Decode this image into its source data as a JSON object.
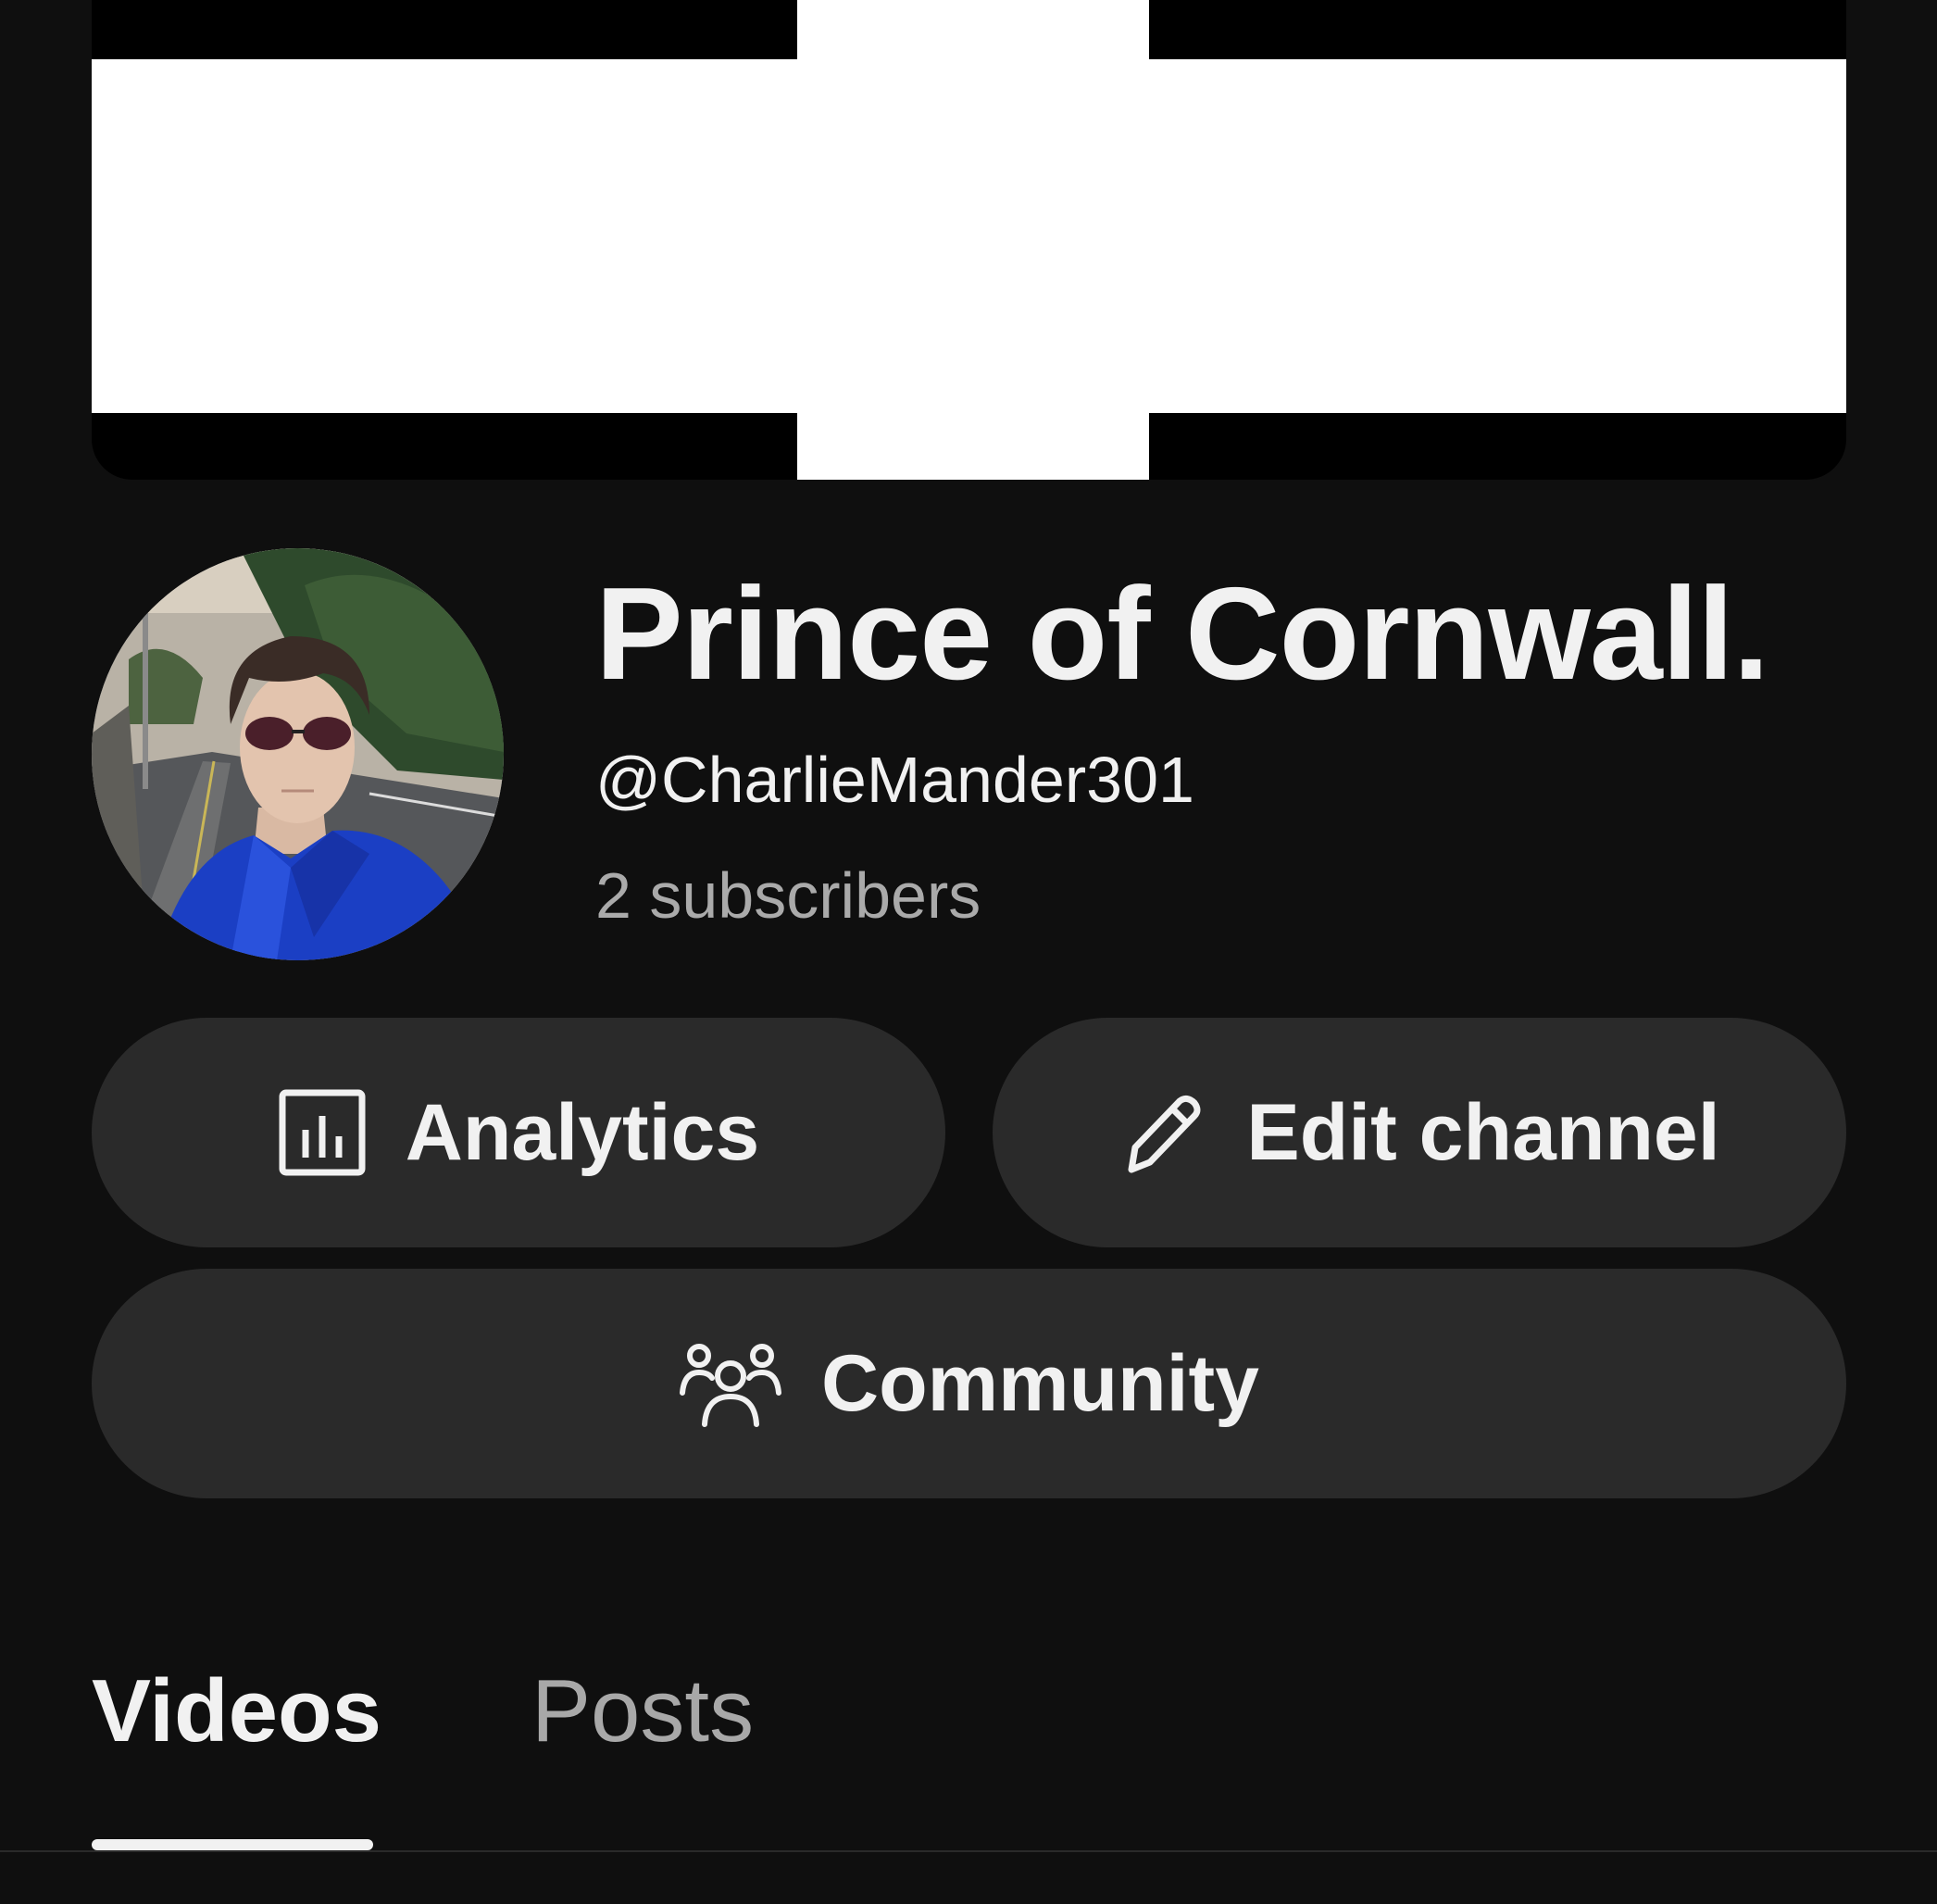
{
  "banner": {
    "colors": {
      "background": "#000000",
      "cross": "#ffffff"
    }
  },
  "channel": {
    "name": "Prince of Cornwall.",
    "handle": "@CharlieMander301",
    "subscribers": "2 subscribers"
  },
  "actions": {
    "analytics_label": "Analytics",
    "analytics_icon": "analytics-chart-icon",
    "edit_label": "Edit channel",
    "edit_icon": "pencil-icon",
    "community_label": "Community",
    "community_icon": "people-group-icon"
  },
  "tabs": [
    {
      "label": "Videos",
      "selected": true
    },
    {
      "label": "Posts",
      "selected": false
    }
  ],
  "colors": {
    "background": "#0f0f0f",
    "button": "#2a2a2a",
    "text_primary": "#f1f1f1",
    "text_secondary": "#aaaaaa"
  }
}
